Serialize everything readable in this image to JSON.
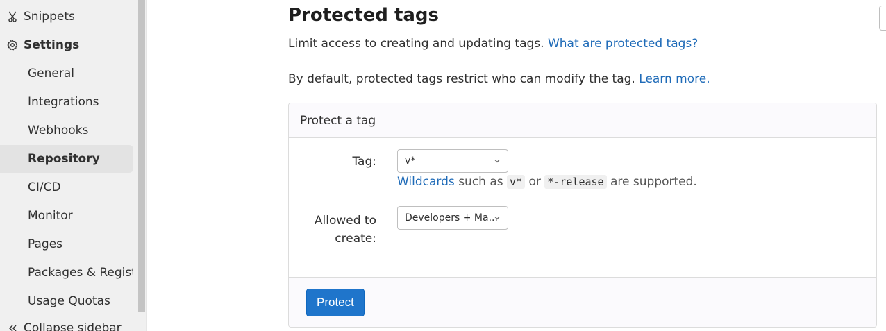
{
  "sidebar": {
    "snippets": "Snippets",
    "settings": "Settings",
    "items": [
      {
        "label": "General"
      },
      {
        "label": "Integrations"
      },
      {
        "label": "Webhooks"
      },
      {
        "label": "Repository"
      },
      {
        "label": "CI/CD"
      },
      {
        "label": "Monitor"
      },
      {
        "label": "Pages"
      },
      {
        "label": "Packages & Registries"
      },
      {
        "label": "Usage Quotas"
      }
    ],
    "collapse": "Collapse sidebar"
  },
  "main": {
    "title": "Protected tags",
    "intro_text": "Limit access to creating and updating tags.",
    "intro_link": "What are protected tags?",
    "default_text": "By default, protected tags restrict who can modify the tag.",
    "learn_more": "Learn more.",
    "card": {
      "header": "Protect a tag",
      "tag_label": "Tag:",
      "tag_value": "v*",
      "help_link": "Wildcards",
      "help_text_1": "such as",
      "help_code_1": "v*",
      "help_text_2": "or",
      "help_code_2": "*-release",
      "help_text_3": "are supported.",
      "allowed_label_1": "Allowed to",
      "allowed_label_2": "create:",
      "allowed_value": "Developers + Ma...",
      "protect_button": "Protect"
    }
  },
  "colors": {
    "link": "#1f6bb8",
    "primary_button": "#1f75cb"
  }
}
